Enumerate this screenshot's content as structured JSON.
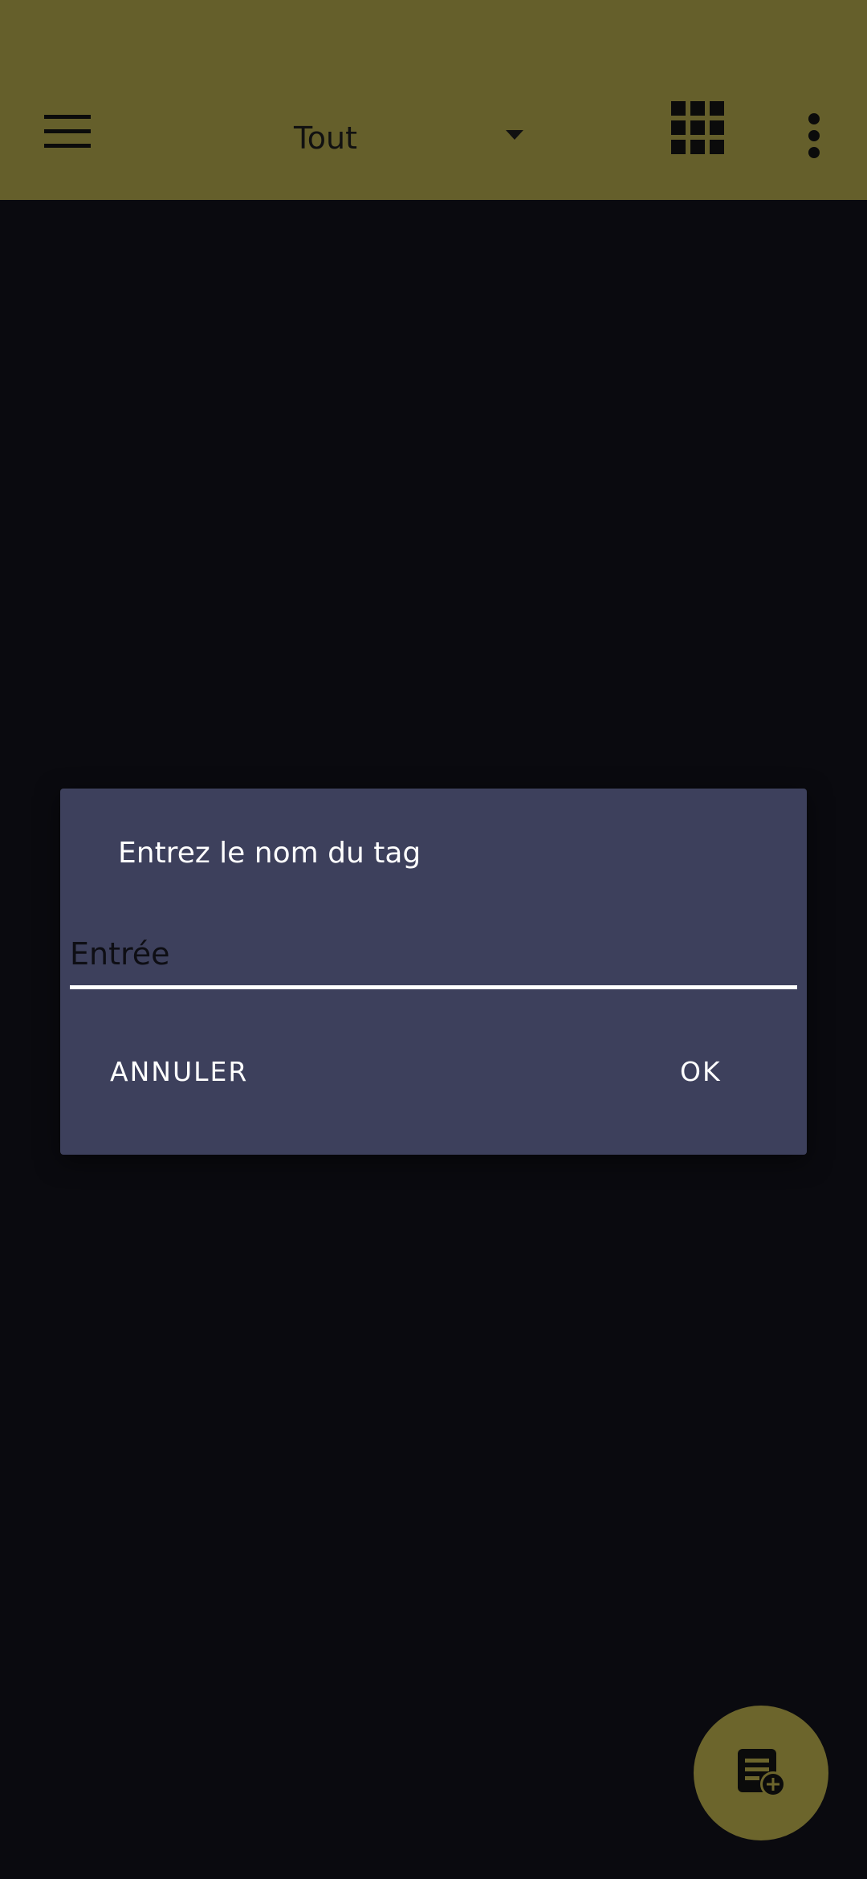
{
  "app_bar": {
    "background": "#655f2b",
    "menu_icon": "hamburger-menu-icon",
    "filter_dropdown": {
      "selected": "Tout",
      "icon": "caret-down-icon"
    },
    "view_toggle_icon": "grid-view-icon",
    "overflow_icon": "more-vertical-icon"
  },
  "dialog": {
    "title": "Entrez le nom du tag",
    "input": {
      "value": "",
      "placeholder": "Entrée"
    },
    "cancel_label": "ANNULER",
    "ok_label": "OK",
    "background": "#3d405c"
  },
  "fab": {
    "icon": "add-note-icon",
    "background": "#6c652c"
  }
}
